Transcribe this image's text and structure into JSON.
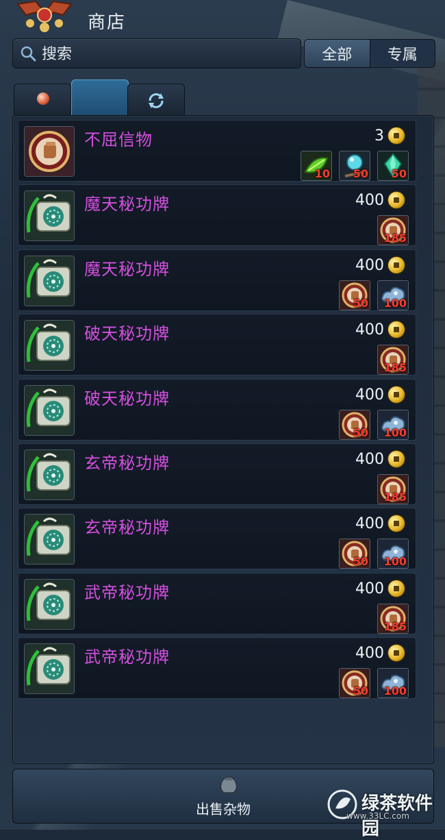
{
  "header": {
    "title": "商店"
  },
  "search": {
    "value": "搜索"
  },
  "filter": {
    "options": [
      "全部",
      "专属"
    ],
    "selected": "全部"
  },
  "tabs": [
    {
      "icon": "orb-icon"
    },
    {
      "icon": "blank",
      "active": true
    },
    {
      "icon": "refresh-icon"
    }
  ],
  "items": [
    {
      "name": "不屈信物",
      "price": "3",
      "icon": "fist-medal-icon",
      "costs": [
        {
          "icon": "green-herb-icon",
          "qty": "10"
        },
        {
          "icon": "crystal-orb-icon",
          "qty": "50"
        },
        {
          "icon": "green-crystal-icon",
          "qty": "50"
        }
      ]
    },
    {
      "name": "魔天秘功牌",
      "price": "400",
      "icon": "skill-scroll-icon",
      "costs": [
        {
          "icon": "fist-token-icon",
          "qty": "185"
        }
      ]
    },
    {
      "name": "魔天秘功牌",
      "price": "400",
      "icon": "skill-scroll-icon",
      "costs": [
        {
          "icon": "fist-token-icon",
          "qty": "50"
        },
        {
          "icon": "cloud-ore-icon",
          "qty": "100"
        }
      ]
    },
    {
      "name": "破天秘功牌",
      "price": "400",
      "icon": "skill-scroll-icon",
      "costs": [
        {
          "icon": "fist-token-icon",
          "qty": "185"
        }
      ]
    },
    {
      "name": "破天秘功牌",
      "price": "400",
      "icon": "skill-scroll-icon",
      "costs": [
        {
          "icon": "fist-token-icon",
          "qty": "50"
        },
        {
          "icon": "cloud-ore-icon",
          "qty": "100"
        }
      ]
    },
    {
      "name": "玄帝秘功牌",
      "price": "400",
      "icon": "skill-scroll-icon",
      "costs": [
        {
          "icon": "fist-token-icon",
          "qty": "185"
        }
      ]
    },
    {
      "name": "玄帝秘功牌",
      "price": "400",
      "icon": "skill-scroll-icon",
      "costs": [
        {
          "icon": "fist-token-icon",
          "qty": "50"
        },
        {
          "icon": "cloud-ore-icon",
          "qty": "100"
        }
      ]
    },
    {
      "name": "武帝秘功牌",
      "price": "400",
      "icon": "skill-scroll-icon",
      "costs": [
        {
          "icon": "fist-token-icon",
          "qty": "185"
        }
      ]
    },
    {
      "name": "武帝秘功牌",
      "price": "400",
      "icon": "skill-scroll-icon",
      "costs": [
        {
          "icon": "fist-token-icon",
          "qty": "50"
        },
        {
          "icon": "cloud-ore-icon",
          "qty": "100"
        }
      ]
    }
  ],
  "footer": {
    "sell_label": "出售杂物"
  },
  "watermark": {
    "text": "绿茶软件园",
    "sub": "www.33LC.com"
  },
  "colors": {
    "item_name": "#d64fe0",
    "cost_qty": "#ff3b2b",
    "coin": "#e8b626"
  }
}
